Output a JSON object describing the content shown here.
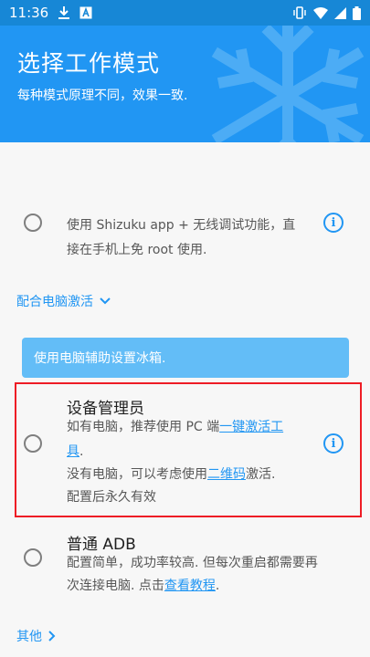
{
  "status_bar": {
    "time": "11:36",
    "icons_left": [
      "download-icon",
      "app-a-icon"
    ],
    "icons_right": [
      "vibrate-icon",
      "wifi-icon",
      "cell-signal-icon",
      "battery-icon"
    ]
  },
  "header": {
    "title": "选择工作模式",
    "subtitle": "每种模式原理不同，效果一致."
  },
  "shizuku_option": {
    "line1": "使用 Shizuku app + 无线调试功能，直",
    "line2": "接在手机上免 root 使用."
  },
  "pc_section": {
    "label": "配合电脑激活",
    "chevron": "chevron-down-icon"
  },
  "banner": {
    "text": "使用电脑辅助设置冰箱."
  },
  "device_admin_option": {
    "title": "设备管理员",
    "line1_prefix": "如有电脑，推荐使用 PC 端",
    "line1_link": "一键激活工",
    "line2_link": "具",
    "line2_suffix": ".",
    "line3_prefix": "没有电脑，可以考虑使用",
    "line3_link": "二维码",
    "line3_suffix": "激活.",
    "line4": "配置后永久有效"
  },
  "adb_option": {
    "title": "普通 ADB",
    "line1": "配置简单，成功率较高. 但每次重启都需要再",
    "line2_prefix": "次连接电脑. 点击",
    "line2_link": "查看教程",
    "line2_suffix": "."
  },
  "other_section": {
    "label": "其他",
    "chevron": "chevron-right-icon"
  },
  "colors": {
    "primary": "#2196f3",
    "status_bar": "#1787d6",
    "banner": "#63bdf7",
    "highlight": "#ee1c25"
  }
}
